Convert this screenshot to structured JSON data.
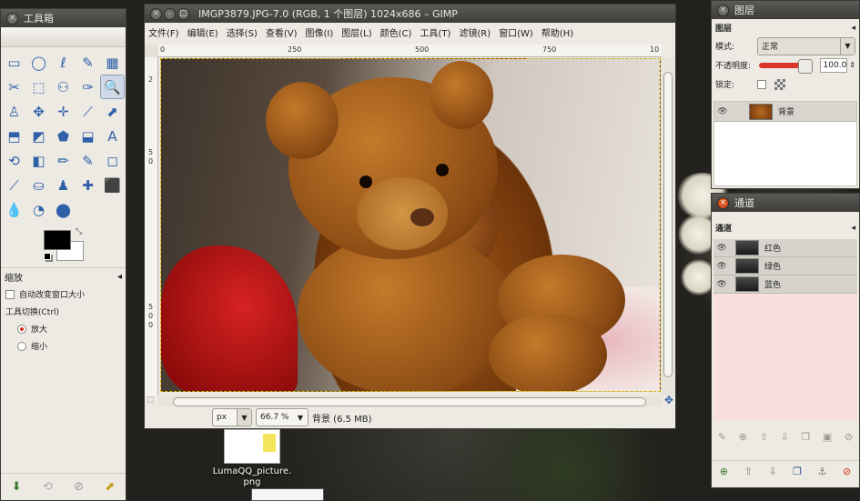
{
  "toolbox": {
    "title": "工具箱",
    "tools": [
      "▭",
      "◯",
      "ℓ",
      "✎",
      "▦",
      "✂",
      "⬚",
      "⚇",
      "✑",
      "🔍",
      "♙",
      "✥",
      "✛",
      "⟋",
      "⬈",
      "⬒",
      "◩",
      "⬟",
      "⬓",
      "A",
      "⟲",
      "◧",
      "✏",
      "✎",
      "◻",
      "⟋",
      "⛀",
      "♟",
      "✚",
      "⬛",
      "💧",
      "◔",
      "⬤"
    ],
    "options_title": "缩放",
    "auto_resize_label": "自动改变窗口大小",
    "toggle_label": "工具切换(Ctrl)",
    "zoom_in_label": "放大",
    "zoom_out_label": "缩小"
  },
  "image_window": {
    "title": "IMGP3879.JPG-7.0 (RGB, 1 个图层) 1024x686 – GIMP",
    "menus": [
      "文件(F)",
      "编辑(E)",
      "选择(S)",
      "查看(V)",
      "图像(I)",
      "图层(L)",
      "颜色(C)",
      "工具(T)",
      "滤镜(R)",
      "窗口(W)",
      "帮助(H)"
    ],
    "hruler_ticks": [
      "0",
      "250",
      "500",
      "750",
      "10"
    ],
    "vruler_ticks": [
      "2",
      "5",
      "0",
      "5",
      "0",
      "0"
    ],
    "unit": "px",
    "zoom": "66.7 %",
    "status": "背景 (6.5 MB)"
  },
  "layers": {
    "title": "图层",
    "header": "图层",
    "mode_label": "模式:",
    "mode_value": "正常",
    "opacity_label": "不透明度:",
    "opacity_value": "100.0",
    "lock_label": "锁定:",
    "layer_name": "背景"
  },
  "channels": {
    "title": "通道",
    "header": "通道",
    "items": [
      "红色",
      "绿色",
      "蓝色"
    ]
  },
  "desktop": {
    "icon_label_1": "LumaQQ_picture.",
    "icon_label_2": "png"
  },
  "colors": {
    "accent_red": "#d9501c",
    "selection": "#d7b400"
  }
}
